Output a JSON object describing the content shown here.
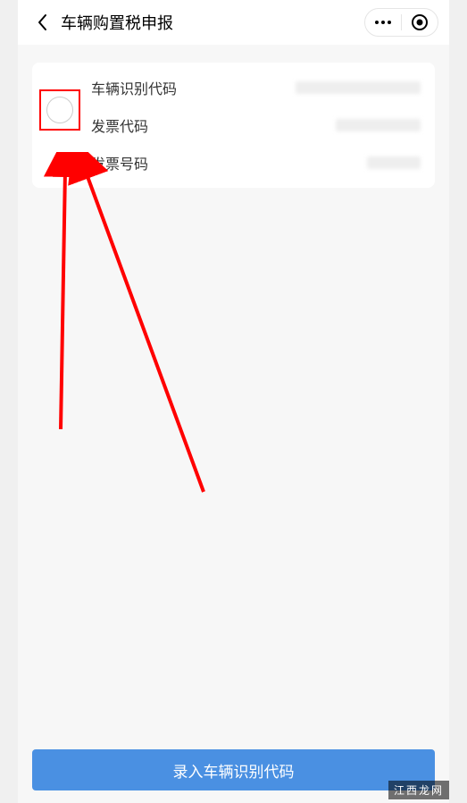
{
  "header": {
    "title": "车辆购置税申报"
  },
  "card": {
    "rows": [
      {
        "label": "车辆识别代码",
        "value": ""
      },
      {
        "label": "发票代码",
        "value": ""
      },
      {
        "label": "发票号码",
        "value": ""
      }
    ]
  },
  "footer": {
    "primary_button": "录入车辆识别代码"
  },
  "watermark": "江西龙网",
  "colors": {
    "primary": "#4a90e2",
    "highlight": "#ff0000"
  }
}
